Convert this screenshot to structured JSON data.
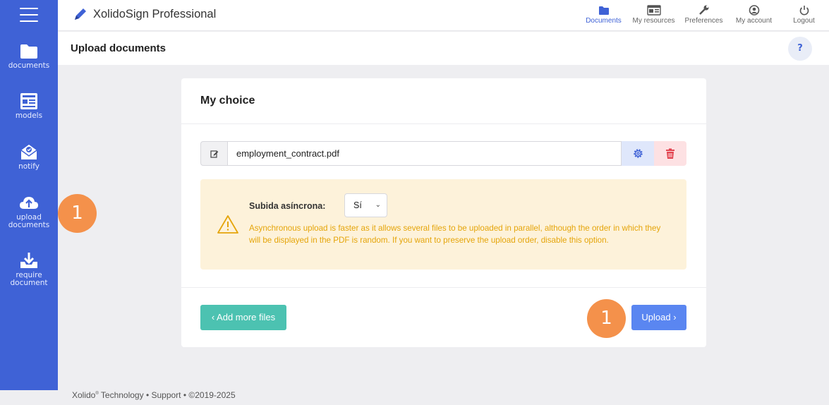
{
  "app": {
    "title": "XolidoSign Professional",
    "accent_color": "#3f62d6"
  },
  "sidebar": {
    "items": [
      {
        "label": "documents",
        "icon": "folder-icon"
      },
      {
        "label": "models",
        "icon": "template-icon"
      },
      {
        "label": "notify",
        "icon": "envelope-icon"
      },
      {
        "label_line1": "upload",
        "label_line2": "documents",
        "icon": "cloud-upload-icon"
      },
      {
        "label_line1": "require",
        "label_line2": "document",
        "icon": "download-tray-icon"
      }
    ]
  },
  "topnav": {
    "items": [
      {
        "label": "Documents",
        "icon": "folder-icon",
        "active": true
      },
      {
        "label": "My resources",
        "icon": "id-card-icon"
      },
      {
        "label": "Preferences",
        "icon": "wrench-icon"
      },
      {
        "label": "My account",
        "icon": "user-circle-icon"
      },
      {
        "label": "Logout",
        "icon": "power-icon"
      }
    ]
  },
  "page": {
    "title": "Upload documents",
    "help_label": "?"
  },
  "card": {
    "title": "My choice",
    "file": {
      "name": "employment_contract.pdf"
    },
    "async": {
      "label": "Subida asíncrona:",
      "selected": "Sí",
      "message": "Asynchronous upload is faster as it allows several files to be uploaded in parallel, although the order in which they will be displayed in the PDF is random. If you want to preserve the upload order, disable this option."
    },
    "add_more_label": "‹ Add more files",
    "upload_label": "Upload ›"
  },
  "badges": {
    "sidebar_badge": "1",
    "upload_badge": "1"
  },
  "footer": {
    "company": "Xolido",
    "company_mark": "®",
    "company_suffix": " Technology",
    "sep1": " • ",
    "support": "Support",
    "sep2": " • ",
    "copyright": "©2019-2025"
  }
}
